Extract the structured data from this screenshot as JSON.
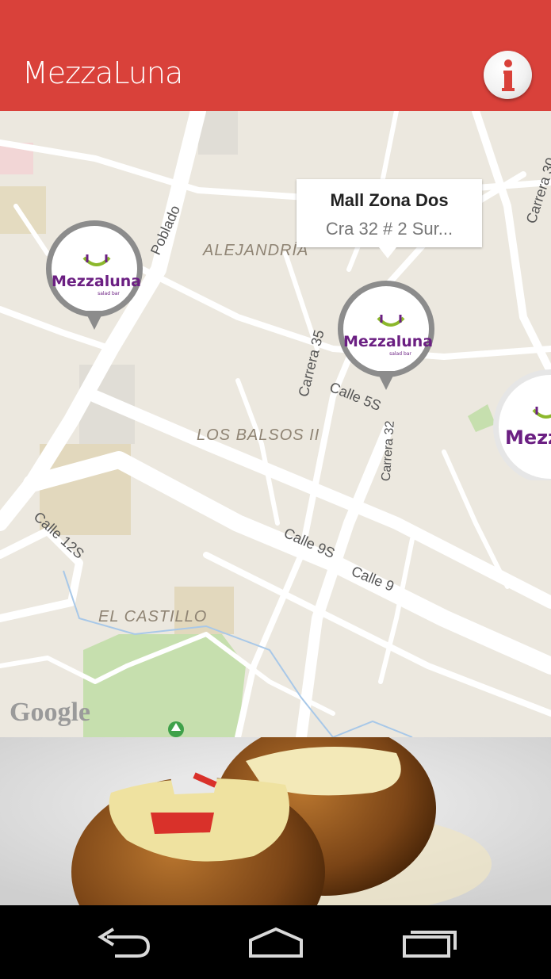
{
  "app": {
    "title": "MezzaLuna"
  },
  "map": {
    "attribution": "Google",
    "areas": [
      "ALEJANDRÍA",
      "LOS BALSOS II",
      "EL CASTILLO"
    ],
    "streets": [
      "Poblado",
      "Carrera 35",
      "Carrera 32",
      "Calle 5S",
      "Calle 12S",
      "Calle 9S",
      "Calle 9",
      "Carrera 30"
    ],
    "markers": [
      {
        "brand": "Mezzaluna",
        "sub": "salad bar"
      },
      {
        "brand": "Mezzaluna",
        "sub": "salad bar"
      },
      {
        "brand": "Mezz",
        "sub": ""
      }
    ],
    "info_window": {
      "title": "Mall Zona Dos",
      "address": "Cra 32 # 2 Sur..."
    }
  },
  "colors": {
    "app_bar": "#d9413a",
    "brand_purple": "#6b1f82",
    "map_bg": "#ece8df",
    "marker_ring": "#8c8c8c"
  },
  "icons": {
    "info": "info-icon",
    "back": "back-icon",
    "home": "home-icon",
    "recents": "recents-icon"
  }
}
